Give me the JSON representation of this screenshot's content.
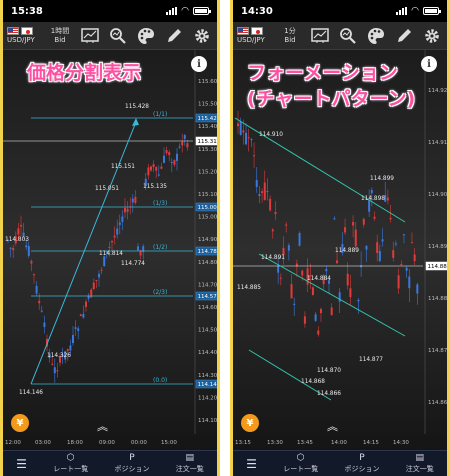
{
  "left": {
    "status_time": "15:38",
    "pair": "USD/JPY",
    "timeframe_line1": "1時間",
    "timeframe_line2": "Bid",
    "caption": "価格分割表示",
    "price_axis": [
      "115.600",
      "115.500",
      "115.400",
      "115.300",
      "115.200",
      "115.100",
      "115.000",
      "114.900",
      "114.800",
      "114.700",
      "114.600",
      "114.500",
      "114.400",
      "114.300",
      "114.200",
      "114.100"
    ],
    "highlight_prices": [
      "115.428",
      "115.313",
      "115.001",
      "114.787",
      "114.573",
      "114.146"
    ],
    "time_axis": [
      "12:00",
      "03:00",
      "18:00",
      "09:00",
      "00:00",
      "15:00"
    ],
    "fib_levels": [
      "(1/1)",
      "(1/3)",
      "(1/2)",
      "(2/3)",
      "(0.0)"
    ],
    "price_labels": [
      "115.428",
      "114.803",
      "115.051",
      "115.151",
      "115.135",
      "114.814",
      "114.774",
      "114.326",
      "114.146"
    ]
  },
  "right": {
    "status_time": "14:30",
    "pair": "USD/JPY",
    "timeframe_line1": "1分",
    "timeframe_line2": "Bid",
    "caption_line1": "フォーメーション",
    "caption_line2": "(チャートパターン)",
    "price_axis": [
      "114.920",
      "114.910",
      "114.900",
      "114.890",
      "114.880",
      "114.870",
      "114.860"
    ],
    "highlight_prices": [
      "114.888"
    ],
    "time_axis": [
      "13:15",
      "13:30",
      "13:45",
      "14:00",
      "14:15",
      "14:30"
    ],
    "price_labels": [
      "114.910",
      "114.899",
      "114.898",
      "114.891",
      "114.889",
      "114.885",
      "114.884",
      "114.877",
      "114.870",
      "114.868",
      "114.866"
    ]
  },
  "nav": {
    "rate_list": "レート一覧",
    "position": "ポジション",
    "order_list": "注文一覧"
  },
  "icons": {
    "yen": "¥",
    "info": "i",
    "chevron": "︽",
    "position_badge": "P"
  }
}
